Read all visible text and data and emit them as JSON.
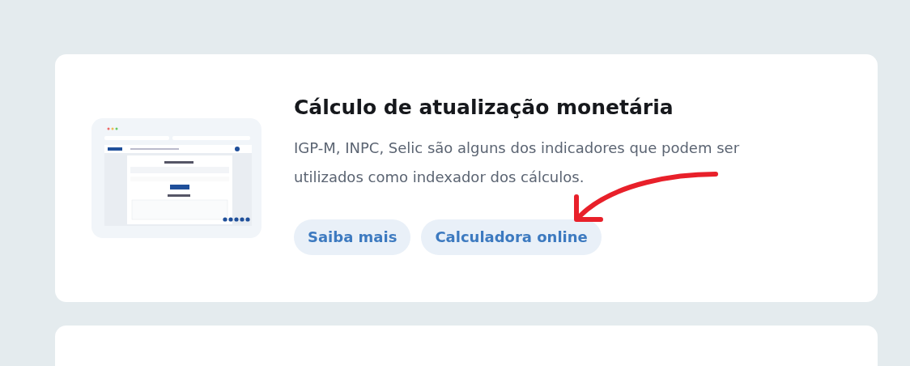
{
  "cards": [
    {
      "title": "Cálculo de atualização monetária",
      "description": "IGP-M, INPC, Selic são alguns dos indicadores que podem ser utilizados como indexador dos cálculos.",
      "links": [
        "Saiba mais",
        "Calculadora online"
      ]
    },
    {
      "kind": "cut_off"
    }
  ]
}
